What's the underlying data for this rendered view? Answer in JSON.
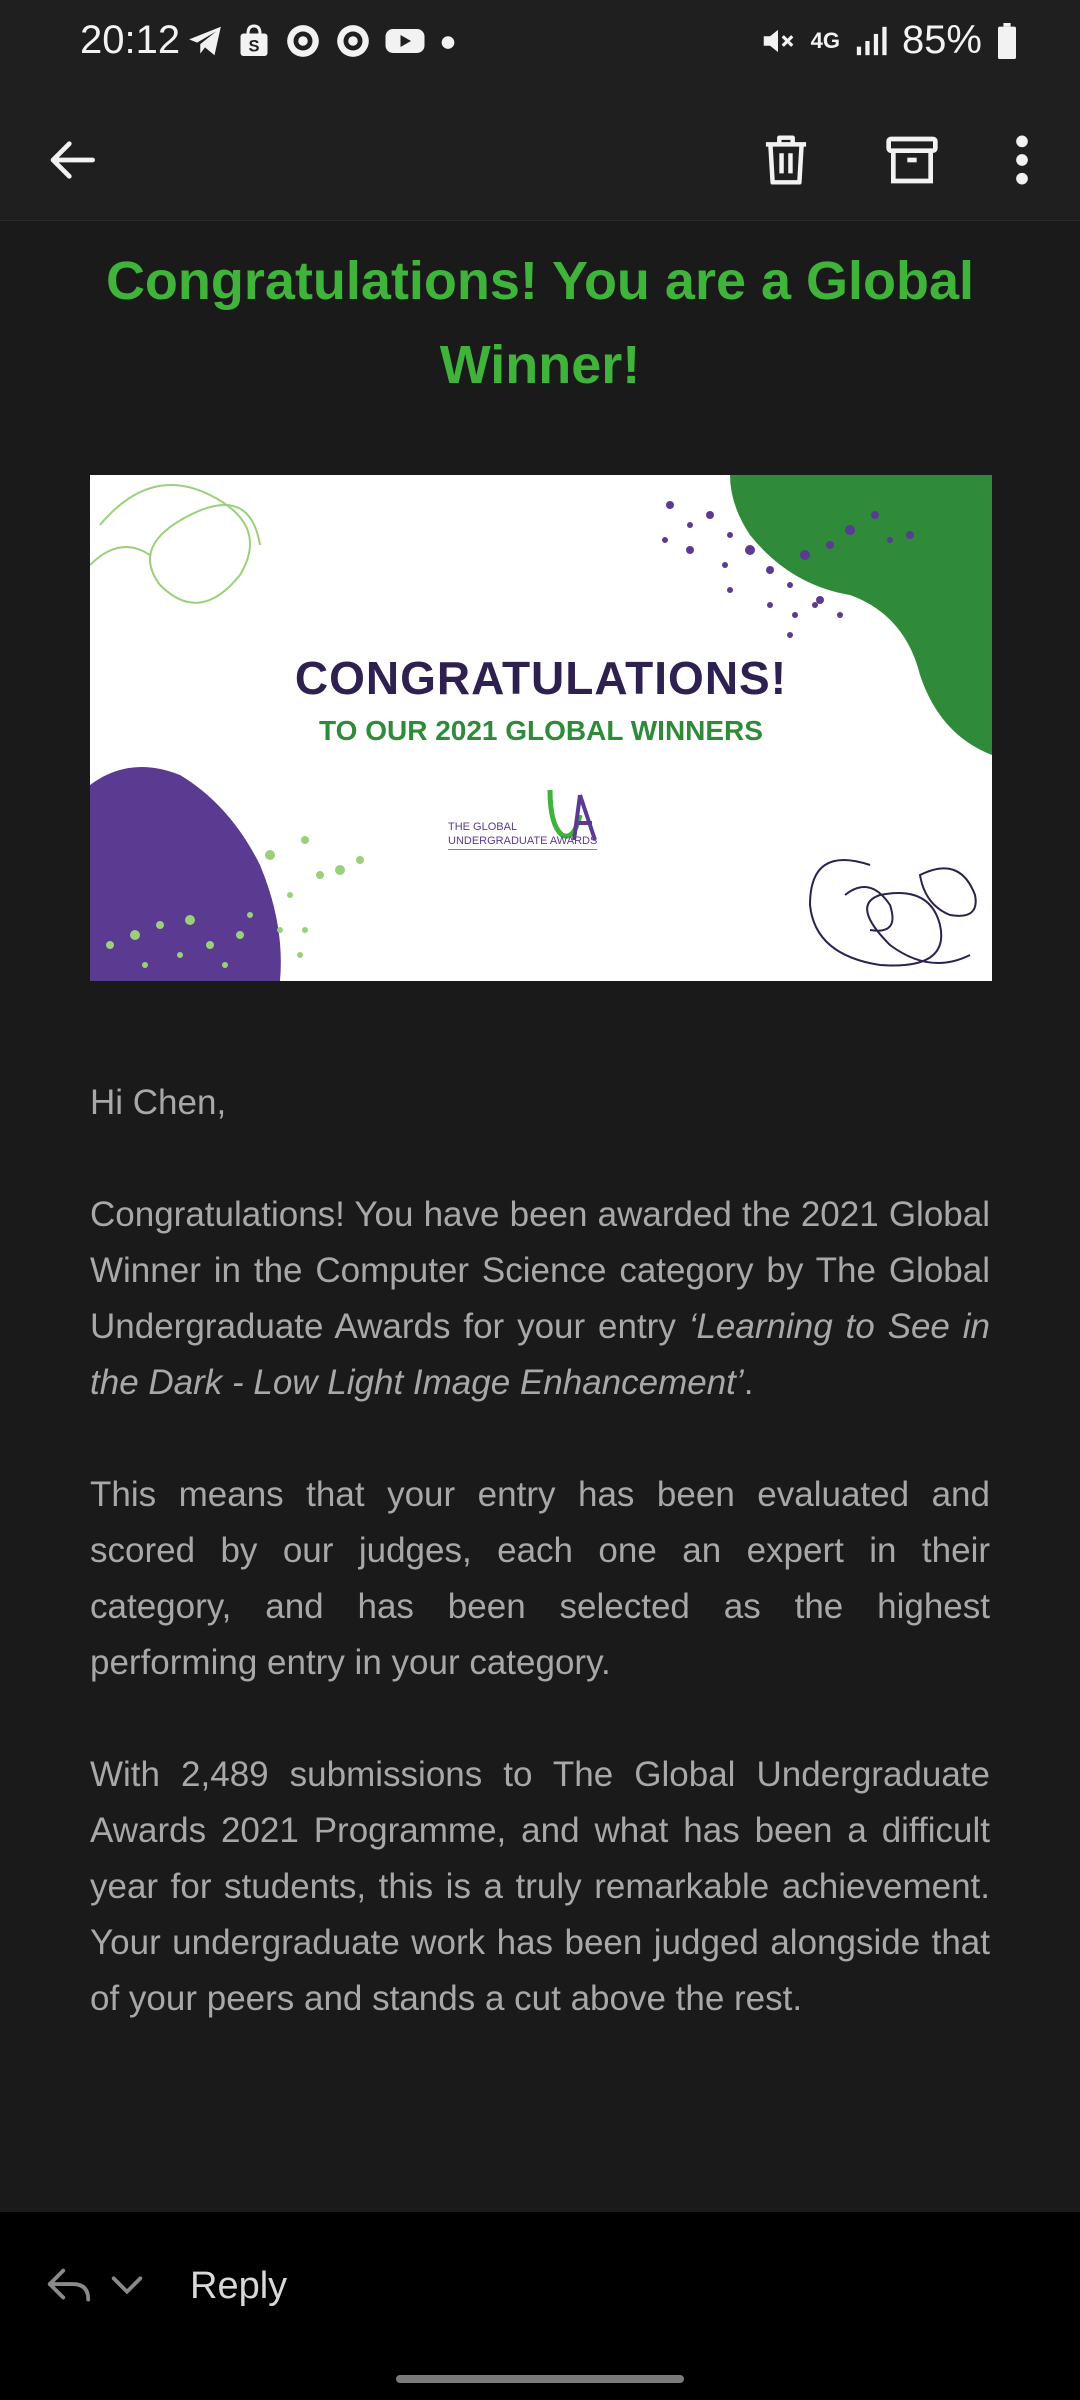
{
  "status_bar": {
    "time": "20:12",
    "network": "4G",
    "battery": "85%",
    "left_icons": [
      "telegram-icon",
      "shopee-icon",
      "target-icon",
      "target-icon",
      "youtube-icon",
      "dot-icon"
    ],
    "right_icons": [
      "mute-icon",
      "signal-icon",
      "battery-icon"
    ]
  },
  "toolbar": {
    "icons": [
      "back-arrow-icon",
      "trash-icon",
      "archive-icon",
      "more-vert-icon"
    ]
  },
  "email": {
    "headline": "Congratulations! You are a Global Winner!",
    "banner": {
      "title": "CONGRATULATIONS!",
      "subtitle": "TO OUR 2021 GLOBAL WINNERS",
      "logo_text_line1": "THE GLOBAL",
      "logo_text_line2": "UNDERGRADUATE AWARDS",
      "logo_mark": "UA"
    },
    "greeting": "Hi Chen,",
    "p1_lead": "Congratulations! You have been awarded the 2021 Global Winner in the Computer Science category by The Global Undergraduate Awards for your entry ",
    "p1_entry": "‘Learning to See in the Dark - Low Light Image Enhancement’",
    "p1_tail": ".",
    "p2": "This means that your entry has been evaluated and scored by our judges, each one an expert in their category, and has been selected as the highest performing entry in your category.",
    "p3": "With 2,489 submissions to The Global Undergraduate Awards 2021 Programme, and what has been a difficult year for students, this is a truly remarkable achievement. Your undergraduate work has been judged alongside that of your peers and stands a cut above the rest."
  },
  "reply_bar": {
    "label": "Reply",
    "icons": [
      "reply-icon",
      "chevron-down-icon"
    ]
  },
  "colors": {
    "background": "#1a1a1a",
    "headline": "#3fb33a",
    "body_text": "#a8a8a8",
    "banner_purple": "#5b3a91",
    "banner_green": "#2f8a3a"
  }
}
